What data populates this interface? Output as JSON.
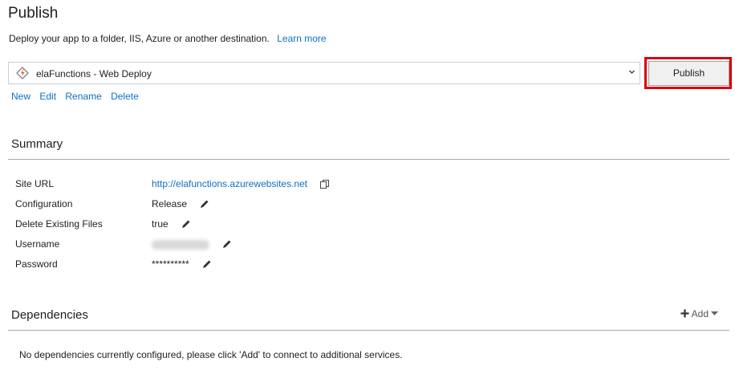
{
  "header": {
    "title": "Publish",
    "subtitle": "Deploy your app to a folder, IIS, Azure or another destination.",
    "learn_more": "Learn more"
  },
  "profile": {
    "selected": "elaFunctions - Web Deploy",
    "icon": "web-deploy-icon"
  },
  "publish_button": {
    "label": "Publish"
  },
  "profile_actions": [
    "New",
    "Edit",
    "Rename",
    "Delete"
  ],
  "summary": {
    "heading": "Summary",
    "rows": [
      {
        "label": "Site URL",
        "value": "http://elafunctions.azurewebsites.net"
      },
      {
        "label": "Configuration",
        "value": "Release"
      },
      {
        "label": "Delete Existing Files",
        "value": "true"
      },
      {
        "label": "Username",
        "value": ""
      },
      {
        "label": "Password",
        "value": "**********"
      }
    ]
  },
  "dependencies": {
    "heading": "Dependencies",
    "add_label": "Add",
    "empty_message": "No dependencies currently configured, please click 'Add' to connect to additional services."
  },
  "colors": {
    "link": "#0e70c0",
    "highlight": "#d8000a",
    "rule": "#a8a8a8"
  }
}
